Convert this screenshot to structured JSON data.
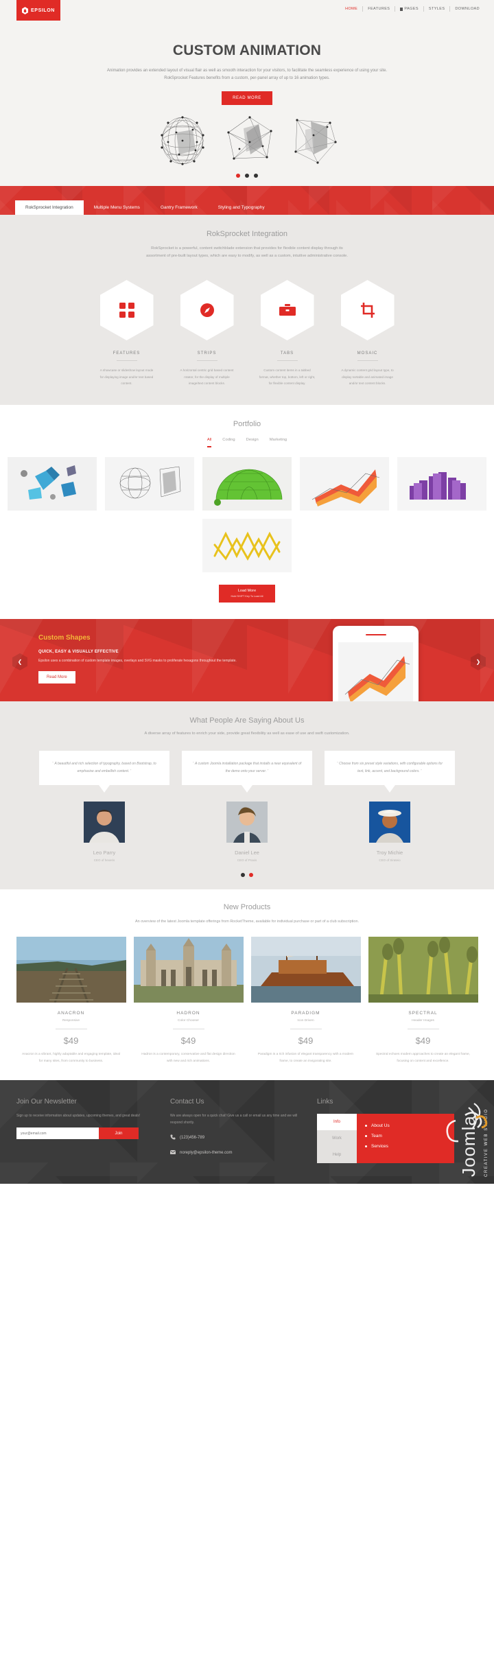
{
  "brand": {
    "name": "EPSILON",
    "accent": "#e02b26",
    "logo_icon": "hexagon-drop-icon"
  },
  "topnav": {
    "items": [
      {
        "label": "HOME",
        "active": true
      },
      {
        "label": "FEATURES",
        "active": false
      },
      {
        "label": "PAGES",
        "active": false,
        "icon": "page-icon"
      },
      {
        "label": "STYLES",
        "active": false
      },
      {
        "label": "DOWNLOAD",
        "active": false
      }
    ]
  },
  "hero": {
    "title": "CUSTOM ANIMATION",
    "line1": "Animation provides an extended layout of visual flair as well as smooth interaction for your visitors, to facilitate the seamless experience of using your site.",
    "line2": "RokSprocket Features benefits from a custom, per-panel array of up to 16 animation types.",
    "button": "READ MORE",
    "dots": 3,
    "active_dot": 0
  },
  "tabs": {
    "items": [
      {
        "label": "RokSprocket Integration",
        "active": true
      },
      {
        "label": "Multiple Menu Systems",
        "active": false
      },
      {
        "label": "Gantry Framework",
        "active": false
      },
      {
        "label": "Styling and Typography",
        "active": false
      }
    ]
  },
  "roksprocket": {
    "title": "RokSprocket Integration",
    "line1": "RokSprocket is a powerful, content switchblade extension that provides for flexible content display through its",
    "line2": "assortment of pre-built layout types, which are easy to modify, as well as a custom, intuitive administrative console.",
    "features": [
      {
        "icon": "grid-squares-icon",
        "title": "FEATURES",
        "desc": "A showcase or slideshow layout mode for displaying image and/or text based content."
      },
      {
        "icon": "compass-icon",
        "title": "STRIPS",
        "desc": "A horizontal centric grid based content rotator, for the display of multiple image/text content blocks."
      },
      {
        "icon": "briefcase-icon",
        "title": "TABS",
        "desc": "Custom content items in a tabbed format, whether top, bottom, left or right, for flexible content display."
      },
      {
        "icon": "crop-icon",
        "title": "MOSAIC",
        "desc": "A dynamic content grid layout type, to display sortable and animated image and/or text content blocks."
      }
    ]
  },
  "portfolio": {
    "title": "Portfolio",
    "filters": [
      {
        "label": "All",
        "active": true
      },
      {
        "label": "Coding",
        "active": false
      },
      {
        "label": "Design",
        "active": false
      },
      {
        "label": "Marketing",
        "active": false
      }
    ],
    "items": [
      {
        "name": "blue-polyhedra-render"
      },
      {
        "name": "wireframe-spheres-render"
      },
      {
        "name": "green-geodesic-dome-render"
      },
      {
        "name": "orange-line-chart-render"
      },
      {
        "name": "purple-bar-blocks-render"
      },
      {
        "name": "yellow-wave-coil-render"
      }
    ],
    "load_more": {
      "label": "Load More",
      "hint": "Hold SHIFT Key To Load All"
    }
  },
  "custom_shapes": {
    "title": "Custom Shapes",
    "subtitle": "QUICK, EASY & VISUALLY EFFECTIVE",
    "body": "Epsilon uses a combination of custom template images, overlays and SVG masks to proliferate hexagons throughout the template.",
    "button": "Read More",
    "prev_icon": "chevron-left-icon",
    "next_icon": "chevron-right-icon",
    "title_color": "#f3b63a"
  },
  "testimonials": {
    "title": "What People Are Saying About Us",
    "subtitle": "A diverse array of features to enrich your side, provide great flexibility as well as ease of use and swift customization.",
    "items": [
      {
        "quote": "A beautiful and rich selection of typography, based on Bootstrap, to emphasise and embellish content.",
        "name": "Leo Parry",
        "role": "CEO of hexeris",
        "avatar": "man-portrait-dark"
      },
      {
        "quote": "A custom Joomla installation package that installs a near equivalent of the demo onto your server.",
        "name": "Daniel Lee",
        "role": "CEO of Praxis",
        "avatar": "woman-portrait-light"
      },
      {
        "quote": "Choose from six preset style variations, with configurable options for text, link, accent, and background colors.",
        "name": "Troy Michie",
        "role": "CEO of Sirateio",
        "avatar": "man-hat-blue"
      }
    ],
    "dots": 2,
    "active_dot": 1
  },
  "new_products": {
    "title": "New Products",
    "subtitle": "An overview of the latest Joomla template offerings from RocketTheme, available for individual purchase or part of a club subscription.",
    "items": [
      {
        "name": "ANACRON",
        "tag": "Responsive",
        "price": "$49",
        "desc": "Anacron is a vibrant, highly adaptable and engaging template, ideal for many sites, from community to business.",
        "image": "railway-tracks-photo"
      },
      {
        "name": "HADRON",
        "tag": "Color Chooser",
        "price": "$49",
        "desc": "Hadron is a contemporary, conservative and flat design direction with new and rich animations.",
        "image": "college-building-photo"
      },
      {
        "name": "PARADIGM",
        "tag": "Icon Driven",
        "price": "$49",
        "desc": "Paradigm is a rich infusion of elegant transparency with a modern frame, to create an invigorating site.",
        "image": "wooden-boat-photo"
      },
      {
        "name": "SPECTRAL",
        "tag": "Header Images",
        "price": "$49",
        "desc": "Spectral echoes modern approaches to create an elegant frame, focusing on content and excellence.",
        "image": "bamboo-fountain-photo"
      }
    ]
  },
  "footer": {
    "newsletter": {
      "title": "Join Our Newsletter",
      "body": "Sign up to receive information about updates, upcoming themes, and great deals!",
      "placeholder": "your@email.com",
      "value": "",
      "button": "Join"
    },
    "contact": {
      "title": "Contact Us",
      "body": "We are always open for a quick chat! Give us a call or email us any time and we will respond shortly.",
      "phone": "(123)456-789",
      "phone_icon": "phone-icon",
      "email": "noreply@epsilon-theme.com",
      "email_icon": "envelope-icon"
    },
    "links": {
      "title": "Links",
      "tabs": [
        {
          "label": "Info",
          "active": true
        },
        {
          "label": "Work",
          "active": false
        },
        {
          "label": "Help",
          "active": false
        }
      ],
      "items": [
        "About Us",
        "Team",
        "Services"
      ]
    },
    "watermark": "Joomla! CREATIVE WEB STUDIO"
  }
}
